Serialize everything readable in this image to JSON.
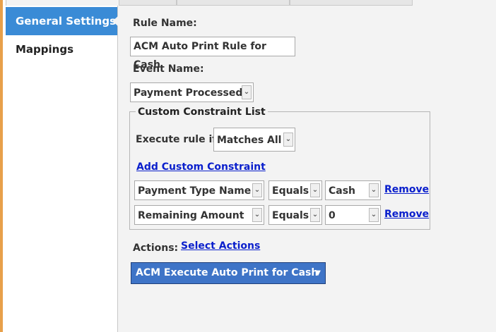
{
  "sidebar": {
    "items": [
      {
        "label": "General Settings",
        "active": true
      },
      {
        "label": "Mappings",
        "active": false
      }
    ]
  },
  "form": {
    "rule_name_label": "Rule Name:",
    "rule_name_value": "ACM Auto Print Rule for Cash",
    "event_name_label": "Event Name:",
    "event_name_value": "Payment Processed",
    "constraints": {
      "legend": "Custom Constraint List",
      "execute_label": "Execute rule if",
      "execute_value": "Matches All",
      "add_link": "Add Custom Constraint",
      "rows": [
        {
          "field": "Payment Type Name",
          "operator": "Equals",
          "value": "Cash",
          "remove": "Remove"
        },
        {
          "field": "Remaining Amount",
          "operator": "Equals",
          "value": "0",
          "remove": "Remove"
        }
      ]
    },
    "actions_label": "Actions:",
    "select_actions_link": "Select Actions",
    "action_button": "ACM Execute Auto Print for Cash",
    "icons": {
      "dropdown": "chevron-down-icon",
      "caret": "caret-down-icon"
    }
  },
  "colors": {
    "accent": "#3a8bd6",
    "action": "#3e74c7",
    "link": "#0a1fcc"
  }
}
